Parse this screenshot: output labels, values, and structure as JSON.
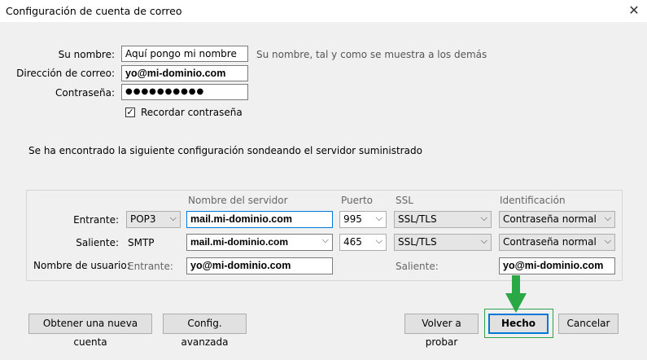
{
  "window": {
    "title": "Configuración de cuenta de correo",
    "close_glyph": "✕"
  },
  "account": {
    "name_label": "Su nombre:",
    "name_value": "Aquí pongo mi nombre",
    "name_hint": "Su nombre, tal y como se muestra a los demás",
    "email_label": "Dirección de correo:",
    "email_value": "yo@mi-dominio.com",
    "password_label": "Contraseña:",
    "password_value": "●●●●●●●●●●",
    "remember_label": "Recordar contraseña",
    "remember_checked": true
  },
  "status_message": "Se ha encontrado la siguiente configuración sondeando el servidor suministrado",
  "server_table": {
    "headers": {
      "server": "Nombre del servidor",
      "port": "Puerto",
      "ssl": "SSL",
      "auth": "Identificación"
    },
    "incoming": {
      "label": "Entrante:",
      "protocol": "POP3",
      "server": "mail.mi-dominio.com",
      "port": "995",
      "ssl": "SSL/TLS",
      "auth": "Contraseña normal"
    },
    "outgoing": {
      "label": "Saliente:",
      "protocol": "SMTP",
      "server": "mail.mi-dominio.com",
      "port": "465",
      "ssl": "SSL/TLS",
      "auth": "Contraseña normal"
    },
    "username": {
      "label": "Nombre de usuario:",
      "incoming_label": "Entrante:",
      "incoming_value": "yo@mi-dominio.com",
      "outgoing_label": "Saliente:",
      "outgoing_value": "yo@mi-dominio.com"
    }
  },
  "buttons": {
    "new_account": "Obtener una nueva cuenta",
    "advanced": "Config. avanzada",
    "retry": "Volver a probar",
    "done": "Hecho",
    "cancel": "Cancelar"
  },
  "annotation": {
    "arrow_color": "#2aa845"
  },
  "icons": {
    "chevron": "chevron-down-icon",
    "arrow": "down-arrow-icon",
    "check": "checkmark-icon"
  }
}
